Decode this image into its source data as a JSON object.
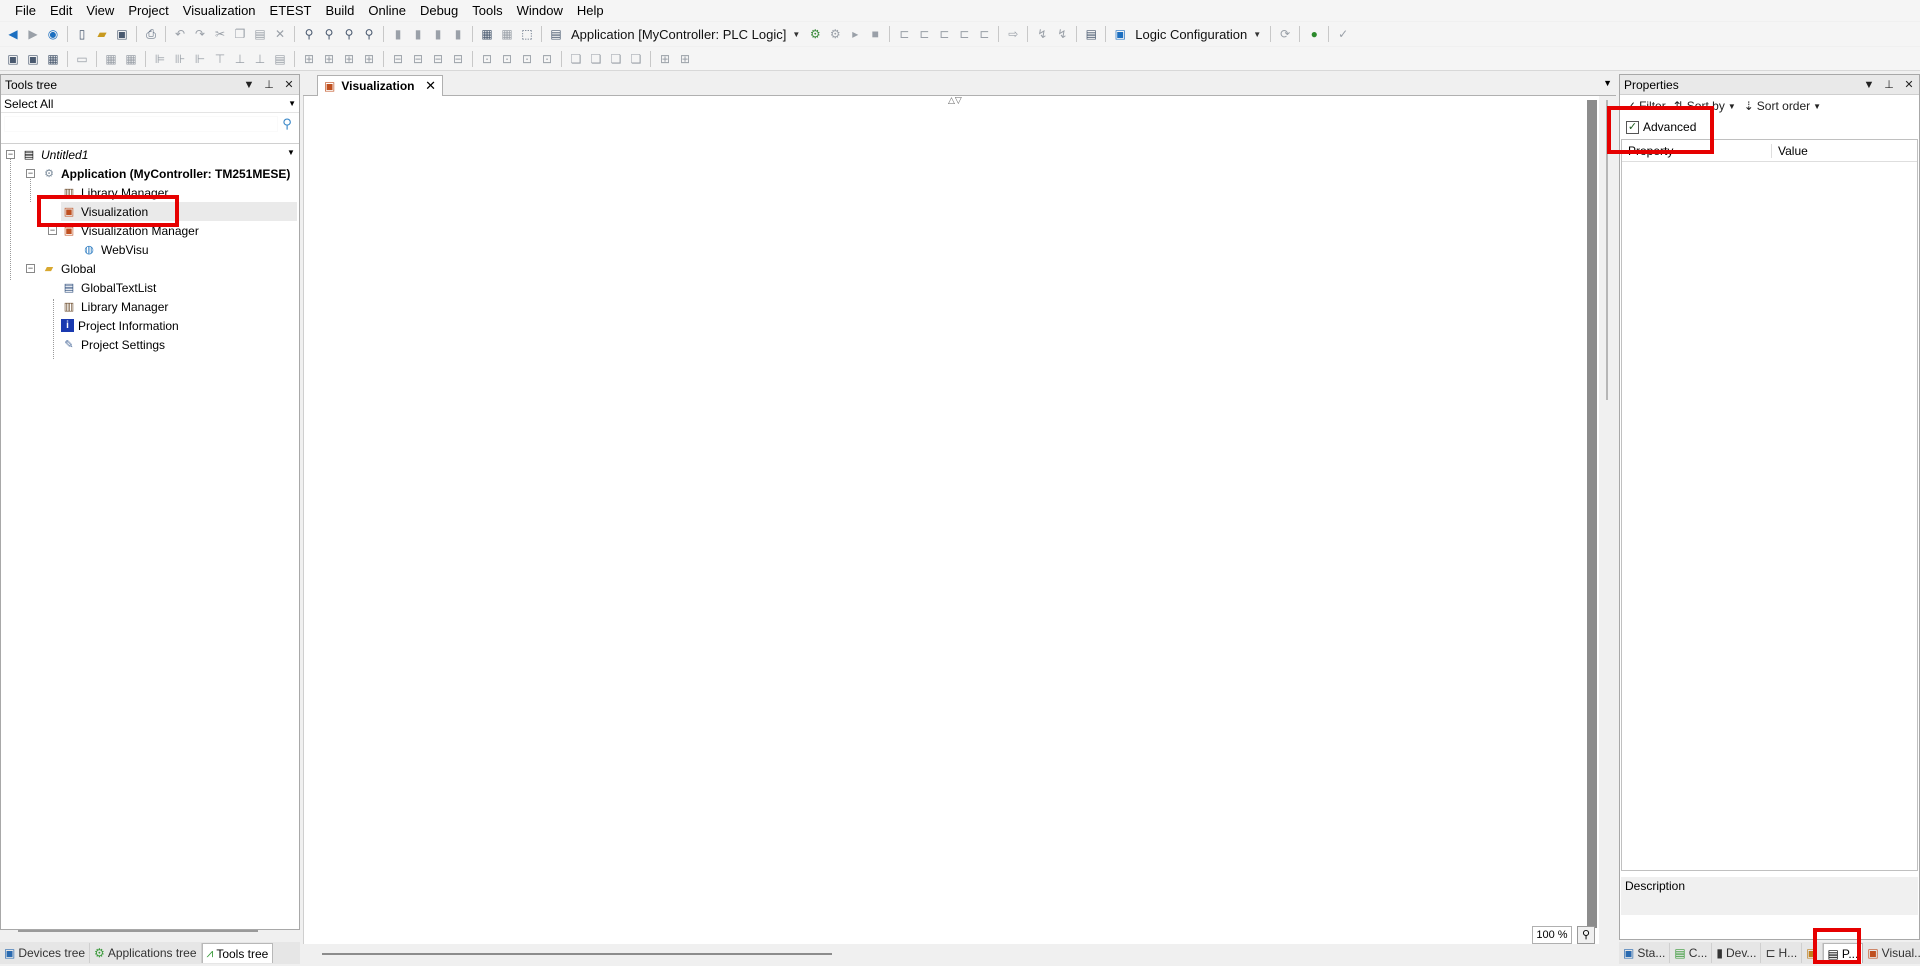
{
  "menu": [
    "File",
    "Edit",
    "View",
    "Project",
    "Visualization",
    "ETEST",
    "Build",
    "Online",
    "Debug",
    "Tools",
    "Window",
    "Help"
  ],
  "toolbar": {
    "application_combo": "Application [MyController: PLC Logic]",
    "config_combo": "Logic Configuration"
  },
  "tools_tree": {
    "title": "Tools tree",
    "filter_value": "Select All",
    "items": [
      {
        "label": "Untitled1"
      },
      {
        "label": "Application (MyController: TM251MESE)"
      },
      {
        "label": "Library Manager"
      },
      {
        "label": "Visualization"
      },
      {
        "label": "Visualization Manager"
      },
      {
        "label": "WebVisu"
      },
      {
        "label": "Global"
      },
      {
        "label": "GlobalTextList"
      },
      {
        "label": "Library Manager"
      },
      {
        "label": "Project Information"
      },
      {
        "label": "Project Settings"
      }
    ]
  },
  "left_tabs": [
    "Devices tree",
    "Applications tree",
    "Tools tree"
  ],
  "editor": {
    "tab_label": "Visualization",
    "zoom": "100 %"
  },
  "properties": {
    "title": "Properties",
    "filter_label": "Filter",
    "sort_by_label": "Sort by",
    "sort_order_label": "Sort order",
    "advanced_label": "Advanced",
    "advanced_checked": true,
    "col_property": "Property",
    "col_value": "Value",
    "description_label": "Description"
  },
  "right_tabs": [
    "Sta...",
    "C...",
    "Dev...",
    "H...",
    "",
    "P...",
    "Visual..."
  ],
  "colors": {
    "highlight": "#e60000"
  }
}
